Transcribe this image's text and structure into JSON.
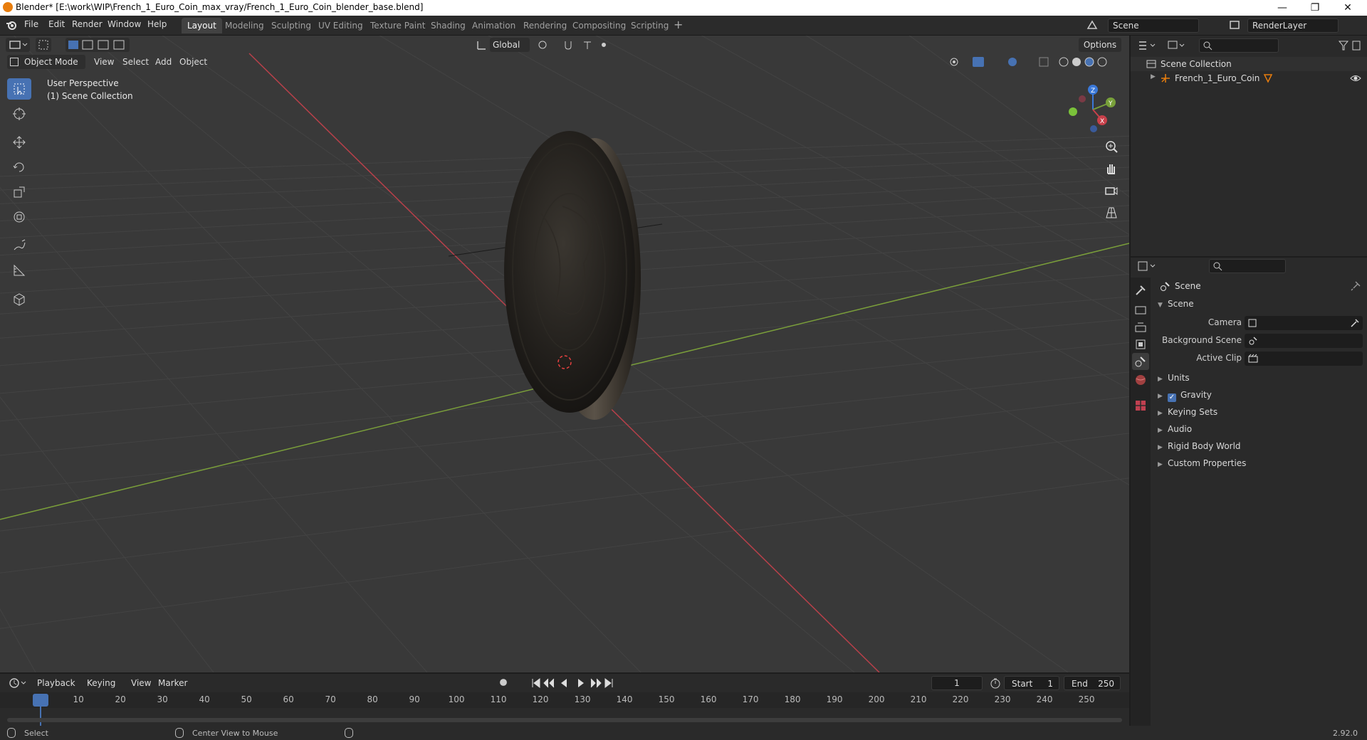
{
  "window": {
    "title": "Blender* [E:\\work\\WIP\\French_1_Euro_Coin_max_vray/French_1_Euro_Coin_blender_base.blend]",
    "minimize": "—",
    "maximize": "❐",
    "close": "✕"
  },
  "menus": [
    "File",
    "Edit",
    "Render",
    "Window",
    "Help"
  ],
  "workspaces": [
    "Layout",
    "Modeling",
    "Sculpting",
    "UV Editing",
    "Texture Paint",
    "Shading",
    "Animation",
    "Rendering",
    "Compositing",
    "Scripting"
  ],
  "workspace_add": "+",
  "scene_selector": "Scene",
  "renderlayer_selector": "RenderLayer",
  "viewport": {
    "mode": "Object Mode",
    "menus": [
      "View",
      "Select",
      "Add",
      "Object"
    ],
    "transform_orientation": "Global",
    "options_label": "Options",
    "overlay_line1": "User Perspective",
    "overlay_line2": "(1) Scene Collection",
    "gizmo_axes": {
      "x": "X",
      "y": "Y",
      "z": "Z"
    }
  },
  "outliner": {
    "root": "Scene Collection",
    "items": [
      {
        "label": "French_1_Euro_Coin"
      }
    ]
  },
  "properties": {
    "context_label": "Scene",
    "section_title": "Scene",
    "fields": [
      {
        "label": "Camera"
      },
      {
        "label": "Background Scene"
      },
      {
        "label": "Active Clip"
      }
    ],
    "panels": [
      "Units",
      "Gravity",
      "Keying Sets",
      "Audio",
      "Rigid Body World",
      "Custom Properties"
    ],
    "gravity_checked": true
  },
  "timeline": {
    "menus": [
      "Playback",
      "Keying",
      "View",
      "Marker"
    ],
    "current_frame": "1",
    "start_label": "Start",
    "start_value": "1",
    "end_label": "End",
    "end_value": "250",
    "ticks": [
      "1",
      "10",
      "20",
      "30",
      "40",
      "50",
      "60",
      "70",
      "80",
      "90",
      "100",
      "110",
      "120",
      "130",
      "140",
      "150",
      "160",
      "170",
      "180",
      "190",
      "200",
      "210",
      "220",
      "230",
      "240",
      "250"
    ]
  },
  "statusbar": {
    "select": "Select",
    "center_view": "Center View to Mouse",
    "version": "2.92.0"
  },
  "colors": {
    "accent": "#4772b3",
    "x_axis": "#c8404a",
    "y_axis": "#78a03a",
    "z_axis": "#3a78d8",
    "origin_marker": "#e87d0d"
  }
}
